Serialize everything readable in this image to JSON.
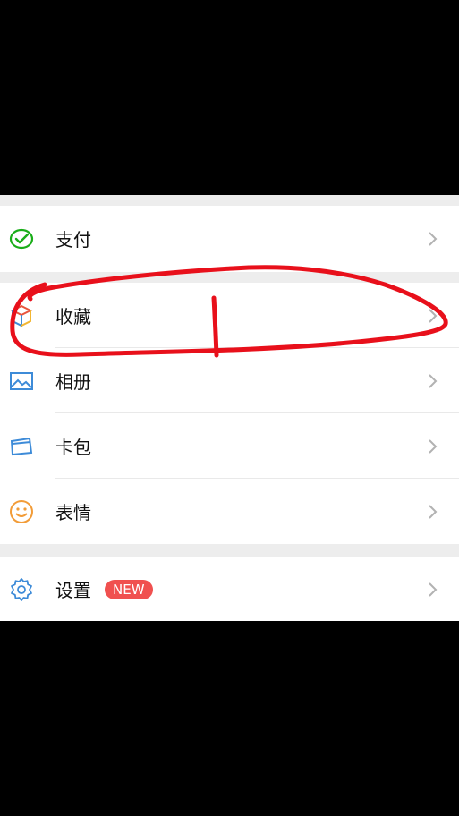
{
  "menu": {
    "payment_label": "支付",
    "favorites_label": "收藏",
    "album_label": "相册",
    "cards_label": "卡包",
    "stickers_label": "表情",
    "settings_label": "设置",
    "settings_badge": "NEW"
  },
  "colors": {
    "annotation_red": "#e8101b",
    "badge_red": "#f0504f",
    "payment_green": "#1aad19",
    "icon_blue": "#3d8bd8",
    "stickers_orange": "#f29c38"
  },
  "icons": {
    "payment": "wallet-check-icon",
    "favorites": "cube-icon",
    "album": "picture-icon",
    "cards": "card-icon",
    "stickers": "smiley-icon",
    "settings": "gear-icon",
    "chevron": "chevron-right-icon"
  }
}
